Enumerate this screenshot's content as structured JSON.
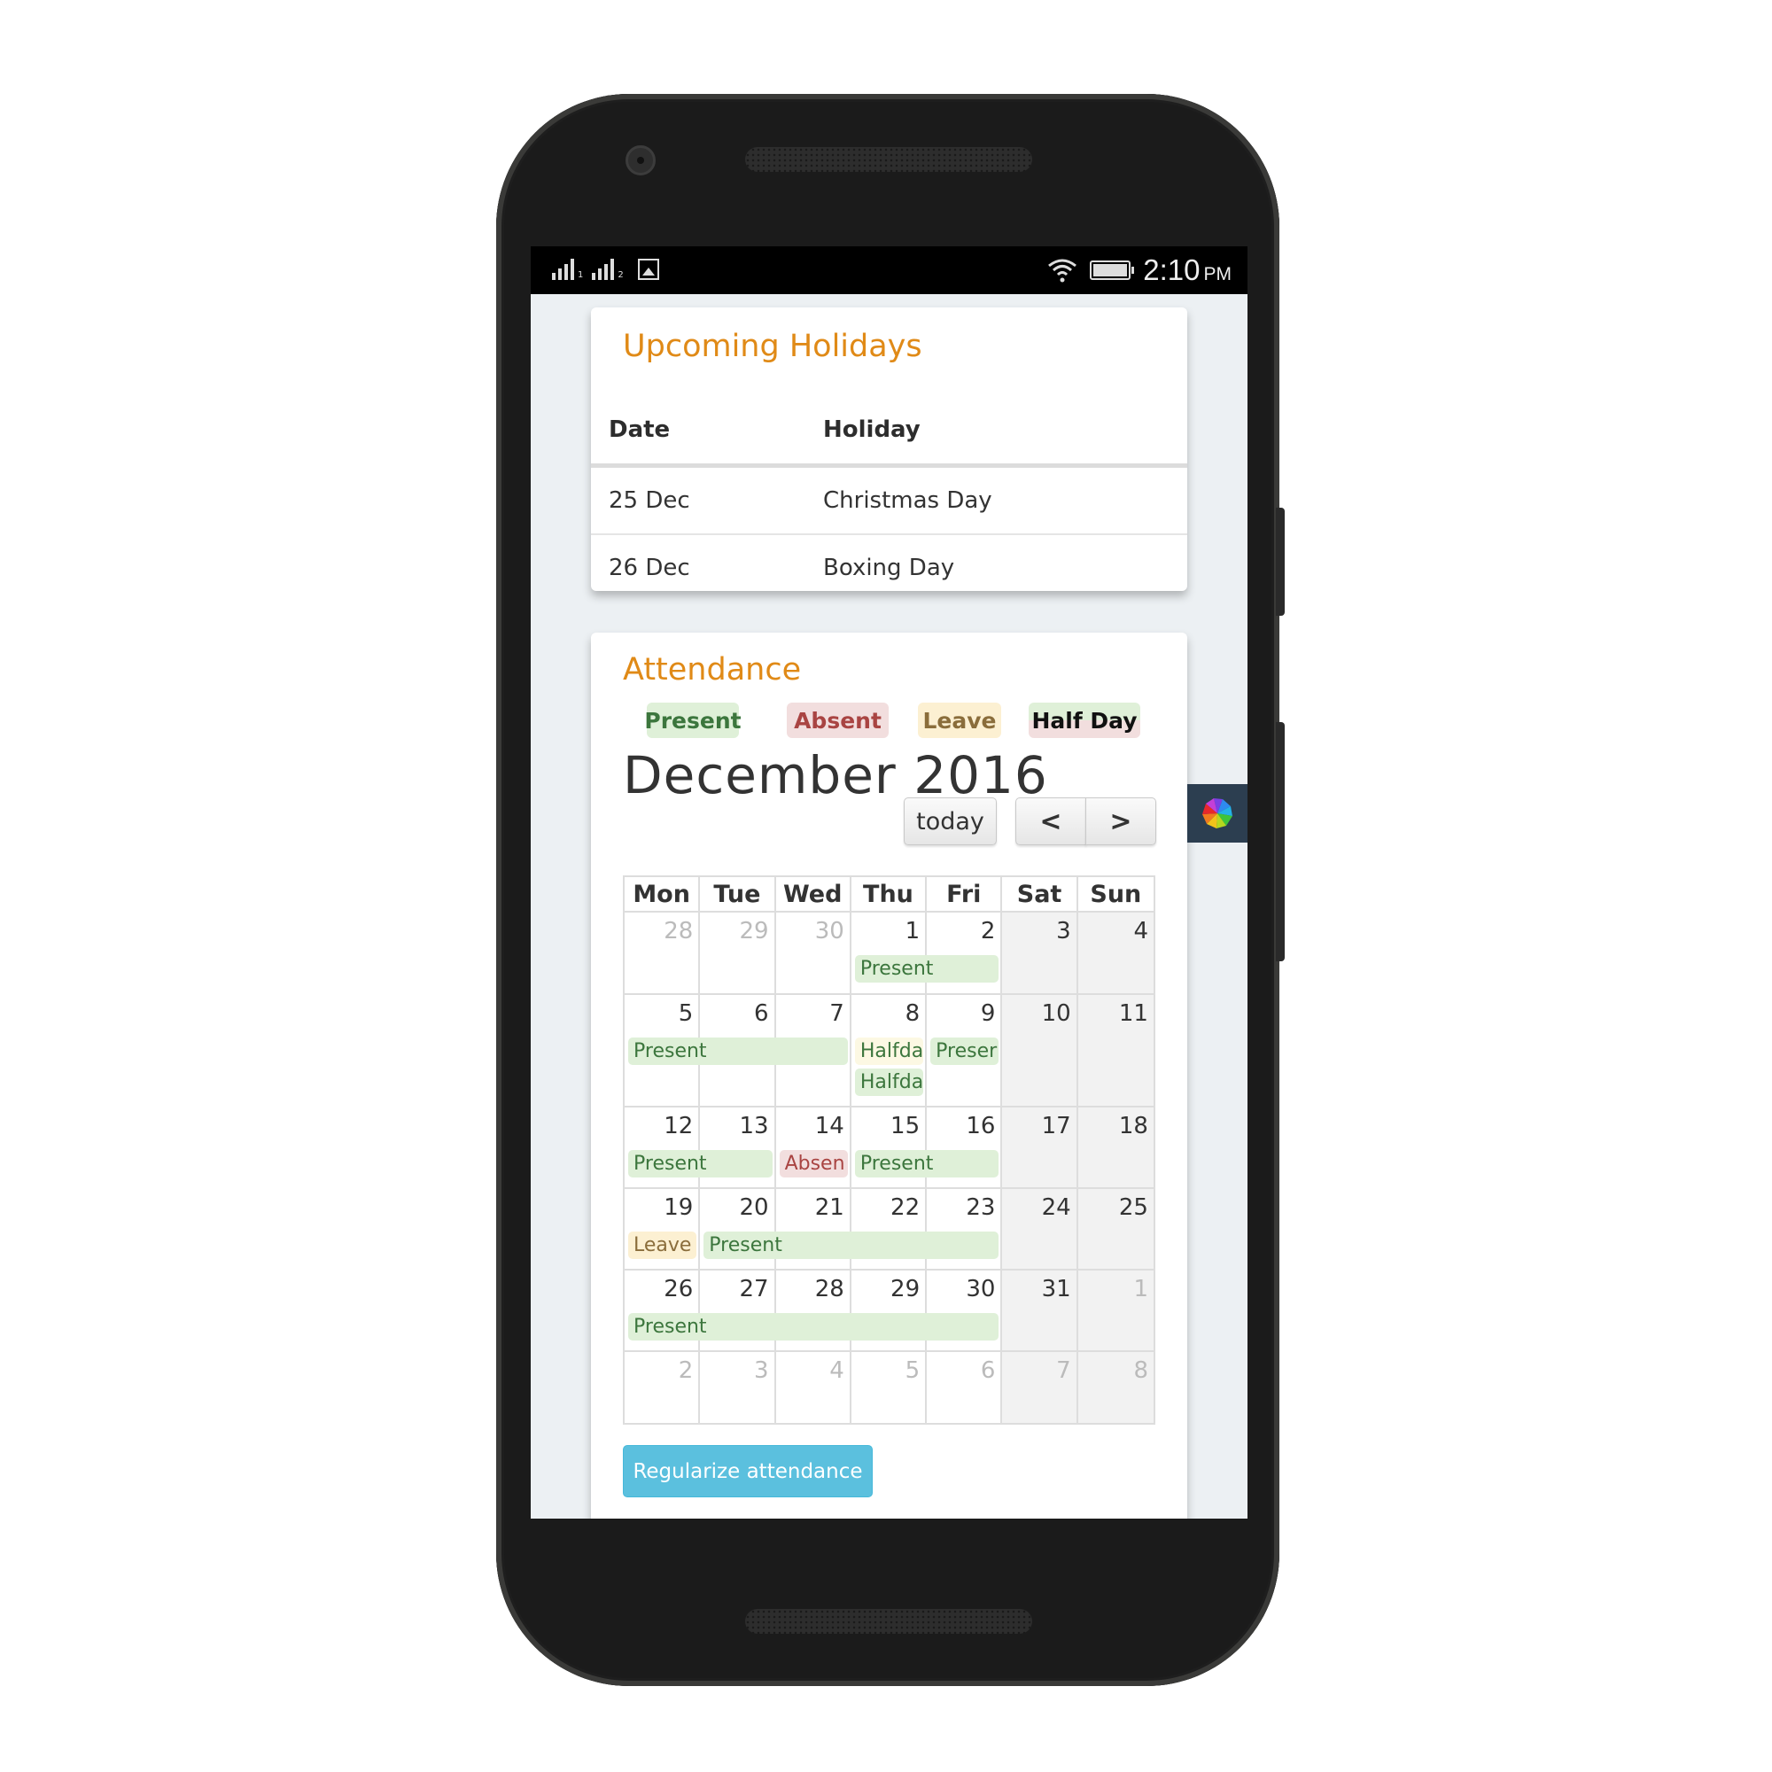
{
  "status_bar": {
    "sim1_label": "1",
    "sim2_label": "2",
    "time": "2:10",
    "ampm": "PM",
    "icons": [
      "signal-sim1-icon",
      "signal-sim2-icon",
      "image-notification-icon",
      "wifi-icon",
      "battery-icon"
    ]
  },
  "holidays": {
    "title": "Upcoming Holidays",
    "columns": [
      "Date",
      "Holiday"
    ],
    "rows": [
      {
        "date": "25 Dec",
        "holiday": "Christmas Day"
      },
      {
        "date": "26 Dec",
        "holiday": "Boxing Day"
      }
    ]
  },
  "attendance": {
    "title": "Attendance",
    "legend": [
      {
        "label": "Present",
        "color": "#dff0d8"
      },
      {
        "label": "Absent",
        "color": "#f2dede"
      },
      {
        "label": "Leave",
        "color": "#fcf0d2"
      },
      {
        "label": "Half Day",
        "color": "#dff0d8/#f2dede"
      }
    ],
    "month_title": "December 2016",
    "today_label": "today",
    "prev_label": "<",
    "next_label": ">",
    "weekdays": [
      "Mon",
      "Tue",
      "Wed",
      "Thu",
      "Fri",
      "Sat",
      "Sun"
    ],
    "weeks": [
      {
        "days": [
          "28",
          "29",
          "30",
          "1",
          "2",
          "3",
          "4"
        ],
        "other": [
          true,
          true,
          true,
          false,
          false,
          false,
          false
        ],
        "events": [
          {
            "label": "Present",
            "type": "present",
            "start": 3,
            "span": 2,
            "row": 0
          }
        ]
      },
      {
        "days": [
          "5",
          "6",
          "7",
          "8",
          "9",
          "10",
          "11"
        ],
        "other": [
          false,
          false,
          false,
          false,
          false,
          false,
          false
        ],
        "events": [
          {
            "label": "Present",
            "type": "present",
            "start": 0,
            "span": 3,
            "row": 0
          },
          {
            "label": "Halfda",
            "type": "halfday-a",
            "start": 3,
            "span": 1,
            "row": 0
          },
          {
            "label": "Preser",
            "type": "present",
            "start": 4,
            "span": 1,
            "row": 0
          },
          {
            "label": "Halfda",
            "type": "halfday-b",
            "start": 3,
            "span": 1,
            "row": 1
          }
        ]
      },
      {
        "days": [
          "12",
          "13",
          "14",
          "15",
          "16",
          "17",
          "18"
        ],
        "other": [
          false,
          false,
          false,
          false,
          false,
          false,
          false
        ],
        "events": [
          {
            "label": "Present",
            "type": "present",
            "start": 0,
            "span": 2,
            "row": 0
          },
          {
            "label": "Absen",
            "type": "absent",
            "start": 2,
            "span": 1,
            "row": 0
          },
          {
            "label": "Present",
            "type": "present",
            "start": 3,
            "span": 2,
            "row": 0
          }
        ]
      },
      {
        "days": [
          "19",
          "20",
          "21",
          "22",
          "23",
          "24",
          "25"
        ],
        "other": [
          false,
          false,
          false,
          false,
          false,
          false,
          false
        ],
        "events": [
          {
            "label": "Leave",
            "type": "leave",
            "start": 0,
            "span": 1,
            "row": 0
          },
          {
            "label": "Present",
            "type": "present",
            "start": 1,
            "span": 4,
            "row": 0
          }
        ]
      },
      {
        "days": [
          "26",
          "27",
          "28",
          "29",
          "30",
          "31",
          "1"
        ],
        "other": [
          false,
          false,
          false,
          false,
          false,
          false,
          true
        ],
        "events": [
          {
            "label": "Present",
            "type": "present",
            "start": 0,
            "span": 5,
            "row": 0
          }
        ]
      },
      {
        "days": [
          "2",
          "3",
          "4",
          "5",
          "6",
          "7",
          "8"
        ],
        "other": [
          true,
          true,
          true,
          true,
          true,
          true,
          true
        ],
        "events": []
      }
    ],
    "regularize_label": "Regularize attendance"
  },
  "floating_widget": {
    "icon": "pinwheel-app-icon"
  }
}
